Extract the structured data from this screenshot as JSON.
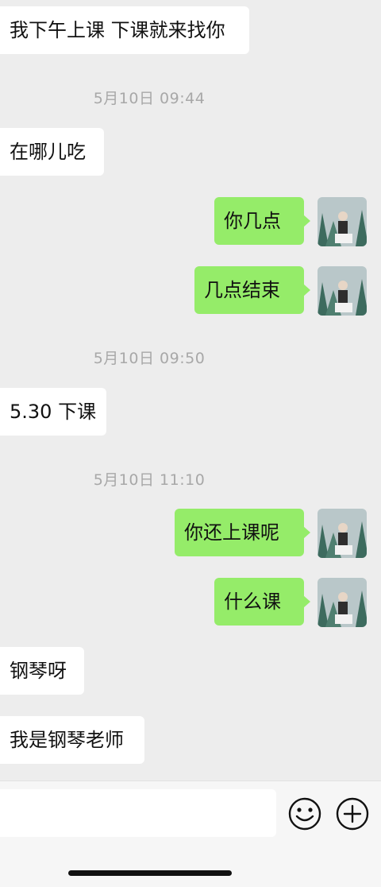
{
  "messages": [
    {
      "side": "in",
      "text": "我下午上课 下课就来找你"
    },
    {
      "side": "ts",
      "text": "5月10日 09:44"
    },
    {
      "side": "in",
      "text": "在哪儿吃"
    },
    {
      "side": "out",
      "text": "你几点"
    },
    {
      "side": "out",
      "text": "几点结束"
    },
    {
      "side": "ts",
      "text": "5月10日 09:50"
    },
    {
      "side": "in",
      "text": "5.30 下课"
    },
    {
      "side": "ts",
      "text": "5月10日 11:10"
    },
    {
      "side": "out",
      "text": "你还上课呢"
    },
    {
      "side": "out",
      "text": "什么课"
    },
    {
      "side": "in",
      "text": "钢琴呀"
    },
    {
      "side": "in",
      "text": "我是钢琴老师"
    }
  ],
  "input": {
    "value": ""
  },
  "icons": {
    "emoji": "emoji-icon",
    "add": "plus-circle-icon"
  },
  "colors": {
    "outgoing": "#95ec69",
    "incoming": "#ffffff",
    "background": "#ededed"
  }
}
